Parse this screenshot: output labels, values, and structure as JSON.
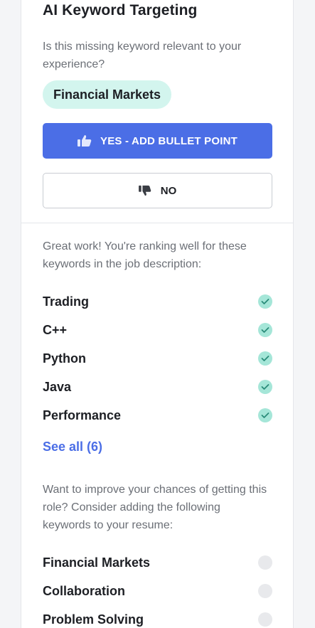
{
  "targeting": {
    "title": "AI Keyword Targeting",
    "question": "Is this missing keyword relevant to your experience?",
    "keyword": "Financial Markets",
    "yes_label": "YES - ADD BULLET POINT",
    "no_label": "NO"
  },
  "ranking": {
    "intro": "Great work! You're ranking well for these keywords in the job description:",
    "matched": [
      {
        "label": "Trading"
      },
      {
        "label": "C++"
      },
      {
        "label": "Python"
      },
      {
        "label": "Java"
      },
      {
        "label": "Performance"
      }
    ],
    "see_all": "See all (6)"
  },
  "improve": {
    "intro": "Want to improve your chances of getting this role? Consider adding the following keywords to your resume:",
    "missing": [
      {
        "label": "Financial Markets"
      },
      {
        "label": "Collaboration"
      },
      {
        "label": "Problem Solving"
      }
    ]
  },
  "colors": {
    "accent": "#4b6ee6",
    "pill": "#d3f5ee",
    "check": "#a5e6d8",
    "check_mark": "#2a8c7a",
    "empty": "#e8e9ec"
  }
}
